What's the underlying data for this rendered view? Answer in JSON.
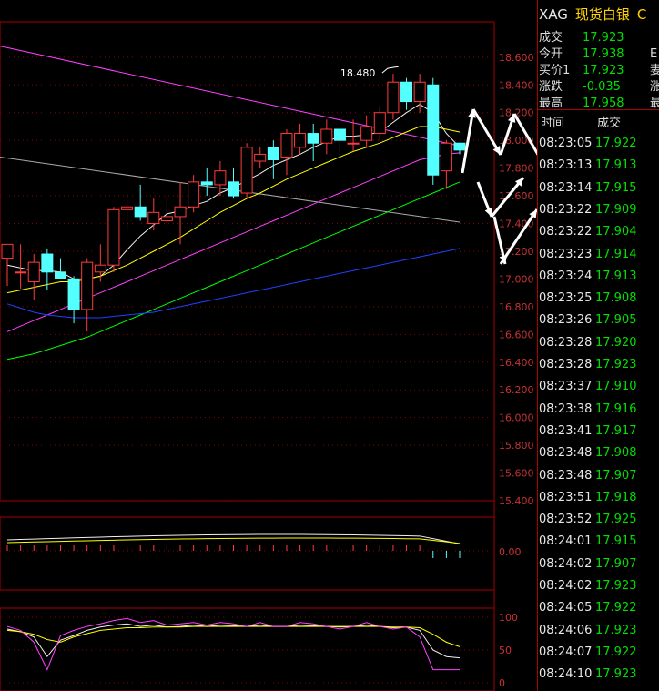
{
  "header": {
    "code": "XAG",
    "name": "现货白银",
    "suffix": "C"
  },
  "quote": [
    {
      "label": "成交",
      "value": "17.923",
      "right": ""
    },
    {
      "label": "今开",
      "value": "17.938",
      "right": "E"
    },
    {
      "label": "买价1",
      "value": "17.923",
      "right": "妻"
    },
    {
      "label": "涨跌",
      "value": "-0.035",
      "right": "涨"
    },
    {
      "label": "最高",
      "value": "17.958",
      "right": "最"
    }
  ],
  "ticks_header": {
    "time": "时间",
    "price": "成交"
  },
  "ticks": [
    {
      "time": "08:23:05",
      "price": "17.922"
    },
    {
      "time": "08:23:13",
      "price": "17.913"
    },
    {
      "time": "08:23:14",
      "price": "17.915"
    },
    {
      "time": "08:23:22",
      "price": "17.909"
    },
    {
      "time": "08:23:22",
      "price": "17.904"
    },
    {
      "time": "08:23:23",
      "price": "17.914"
    },
    {
      "time": "08:23:24",
      "price": "17.913"
    },
    {
      "time": "08:23:25",
      "price": "17.908"
    },
    {
      "time": "08:23:26",
      "price": "17.905"
    },
    {
      "time": "08:23:28",
      "price": "17.920"
    },
    {
      "time": "08:23:28",
      "price": "17.923"
    },
    {
      "time": "08:23:37",
      "price": "17.910"
    },
    {
      "time": "08:23:38",
      "price": "17.916"
    },
    {
      "time": "08:23:41",
      "price": "17.917"
    },
    {
      "time": "08:23:48",
      "price": "17.908"
    },
    {
      "time": "08:23:48",
      "price": "17.907"
    },
    {
      "time": "08:23:51",
      "price": "17.918"
    },
    {
      "time": "08:23:52",
      "price": "17.925"
    },
    {
      "time": "08:24:01",
      "price": "17.915"
    },
    {
      "time": "08:24:02",
      "price": "17.907"
    },
    {
      "time": "08:24:02",
      "price": "17.923"
    },
    {
      "time": "08:24:05",
      "price": "17.922"
    },
    {
      "time": "08:24:06",
      "price": "17.923"
    },
    {
      "time": "08:24:07",
      "price": "17.922"
    },
    {
      "time": "08:24:10",
      "price": "17.923"
    }
  ],
  "colors": {
    "up": "#ff3c3c",
    "down": "#54ffff",
    "grid": "#8a0000",
    "axis_text": "#c83232"
  },
  "chart_data": {
    "type": "candlestick",
    "ylim": [
      15.4,
      18.75
    ],
    "y_ticks": [
      "18.600",
      "18.400",
      "18.200",
      "18.000",
      "17.800",
      "17.600",
      "17.400",
      "17.200",
      "17.000",
      "16.800",
      "16.600",
      "16.400",
      "16.200",
      "16.000",
      "15.800",
      "15.600",
      "15.400"
    ],
    "annotation": "18.480",
    "candles": [
      {
        "o": 17.15,
        "h": 17.25,
        "l": 16.95,
        "c": 17.25
      },
      {
        "o": 17.05,
        "h": 17.25,
        "l": 16.93,
        "c": 17.05
      },
      {
        "o": 16.98,
        "h": 17.18,
        "l": 16.85,
        "c": 17.12
      },
      {
        "o": 17.18,
        "h": 17.22,
        "l": 16.92,
        "c": 17.05
      },
      {
        "o": 17.05,
        "h": 17.15,
        "l": 17.0,
        "c": 17.0
      },
      {
        "o": 17.0,
        "h": 17.02,
        "l": 16.68,
        "c": 16.78
      },
      {
        "o": 16.78,
        "h": 17.15,
        "l": 16.62,
        "c": 17.12
      },
      {
        "o": 17.05,
        "h": 17.25,
        "l": 16.98,
        "c": 17.1
      },
      {
        "o": 17.1,
        "h": 17.52,
        "l": 17.05,
        "c": 17.5
      },
      {
        "o": 17.5,
        "h": 17.62,
        "l": 17.35,
        "c": 17.52
      },
      {
        "o": 17.52,
        "h": 17.68,
        "l": 17.42,
        "c": 17.45
      },
      {
        "o": 17.4,
        "h": 17.58,
        "l": 17.35,
        "c": 17.48
      },
      {
        "o": 17.42,
        "h": 17.6,
        "l": 17.38,
        "c": 17.45
      },
      {
        "o": 17.45,
        "h": 17.7,
        "l": 17.25,
        "c": 17.52
      },
      {
        "o": 17.52,
        "h": 17.75,
        "l": 17.48,
        "c": 17.7
      },
      {
        "o": 17.7,
        "h": 17.8,
        "l": 17.6,
        "c": 17.68
      },
      {
        "o": 17.68,
        "h": 17.85,
        "l": 17.6,
        "c": 17.78
      },
      {
        "o": 17.7,
        "h": 17.8,
        "l": 17.58,
        "c": 17.6
      },
      {
        "o": 17.62,
        "h": 17.98,
        "l": 17.58,
        "c": 17.95
      },
      {
        "o": 17.85,
        "h": 17.95,
        "l": 17.8,
        "c": 17.9
      },
      {
        "o": 17.95,
        "h": 18.0,
        "l": 17.72,
        "c": 17.86
      },
      {
        "o": 17.88,
        "h": 18.08,
        "l": 17.75,
        "c": 18.05
      },
      {
        "o": 17.95,
        "h": 18.12,
        "l": 17.9,
        "c": 18.05
      },
      {
        "o": 18.05,
        "h": 18.12,
        "l": 17.85,
        "c": 17.98
      },
      {
        "o": 17.98,
        "h": 18.15,
        "l": 17.9,
        "c": 18.08
      },
      {
        "o": 18.08,
        "h": 18.05,
        "l": 17.88,
        "c": 18.0
      },
      {
        "o": 17.98,
        "h": 18.15,
        "l": 17.92,
        "c": 17.98
      },
      {
        "o": 18.0,
        "h": 18.18,
        "l": 17.95,
        "c": 18.1
      },
      {
        "o": 18.05,
        "h": 18.25,
        "l": 18.0,
        "c": 18.2
      },
      {
        "o": 18.2,
        "h": 18.48,
        "l": 18.15,
        "c": 18.42
      },
      {
        "o": 18.42,
        "h": 18.45,
        "l": 18.22,
        "c": 18.28
      },
      {
        "o": 18.28,
        "h": 18.48,
        "l": 18.2,
        "c": 18.42
      },
      {
        "o": 18.4,
        "h": 18.45,
        "l": 17.68,
        "c": 17.75
      },
      {
        "o": 17.78,
        "h": 18.0,
        "l": 17.65,
        "c": 17.98
      },
      {
        "o": 17.98,
        "h": 17.98,
        "l": 17.9,
        "c": 17.93
      }
    ],
    "ma": [
      {
        "name": "MA5",
        "color": "#f0f0f0",
        "values": [
          17.1,
          17.08,
          17.06,
          17.06,
          17.05,
          17.0,
          17.0,
          17.02,
          17.1,
          17.21,
          17.31,
          17.39,
          17.47,
          17.49,
          17.53,
          17.56,
          17.62,
          17.66,
          17.71,
          17.76,
          17.82,
          17.86,
          17.9,
          17.95,
          17.99,
          18.03,
          18.03,
          18.04,
          18.06,
          18.13,
          18.2,
          18.26,
          18.2,
          18.05,
          17.95
        ]
      },
      {
        "name": "MA10",
        "color": "#ffff00",
        "values": [
          16.9,
          16.92,
          16.94,
          16.96,
          16.98,
          16.98,
          17.0,
          17.02,
          17.06,
          17.1,
          17.15,
          17.2,
          17.25,
          17.3,
          17.36,
          17.42,
          17.48,
          17.53,
          17.58,
          17.62,
          17.67,
          17.72,
          17.76,
          17.8,
          17.84,
          17.88,
          17.92,
          17.95,
          17.98,
          18.02,
          18.06,
          18.1,
          18.1,
          18.08,
          18.06
        ]
      },
      {
        "name": "MA20",
        "color": "#ff40ff",
        "values": [
          16.62,
          16.66,
          16.7,
          16.74,
          16.78,
          16.82,
          16.86,
          16.9,
          16.94,
          16.98,
          17.02,
          17.06,
          17.1,
          17.14,
          17.18,
          17.22,
          17.26,
          17.3,
          17.34,
          17.38,
          17.42,
          17.46,
          17.5,
          17.54,
          17.58,
          17.62,
          17.66,
          17.7,
          17.74,
          17.78,
          17.82,
          17.86,
          17.88,
          17.9,
          17.91
        ]
      },
      {
        "name": "MA30",
        "color": "#00ff00",
        "values": [
          16.42,
          16.44,
          16.46,
          16.49,
          16.52,
          16.55,
          16.58,
          16.62,
          16.66,
          16.7,
          16.74,
          16.78,
          16.82,
          16.86,
          16.9,
          16.94,
          16.98,
          17.02,
          17.06,
          17.1,
          17.14,
          17.18,
          17.22,
          17.26,
          17.3,
          17.34,
          17.38,
          17.42,
          17.46,
          17.5,
          17.54,
          17.58,
          17.62,
          17.66,
          17.7
        ]
      },
      {
        "name": "MA60",
        "color": "#2040ff",
        "values": [
          16.82,
          16.79,
          16.76,
          16.74,
          16.73,
          16.72,
          16.72,
          16.72,
          16.73,
          16.74,
          16.75,
          16.76,
          16.78,
          16.8,
          16.82,
          16.84,
          16.86,
          16.88,
          16.9,
          16.92,
          16.94,
          16.96,
          16.98,
          17.0,
          17.02,
          17.04,
          17.06,
          17.08,
          17.1,
          17.12,
          17.14,
          17.16,
          17.18,
          17.2,
          17.22
        ]
      }
    ],
    "upper_lines": [
      {
        "color": "#ff40ff",
        "from": 18.68,
        "to": 17.96
      },
      {
        "color": "#aaaaaa",
        "from": 17.88,
        "to": 17.41
      }
    ],
    "macd_panel": {
      "zero_label": "0.00"
    },
    "kdj_panel": {
      "y_ticks": [
        "100",
        "50",
        "0"
      ]
    }
  }
}
